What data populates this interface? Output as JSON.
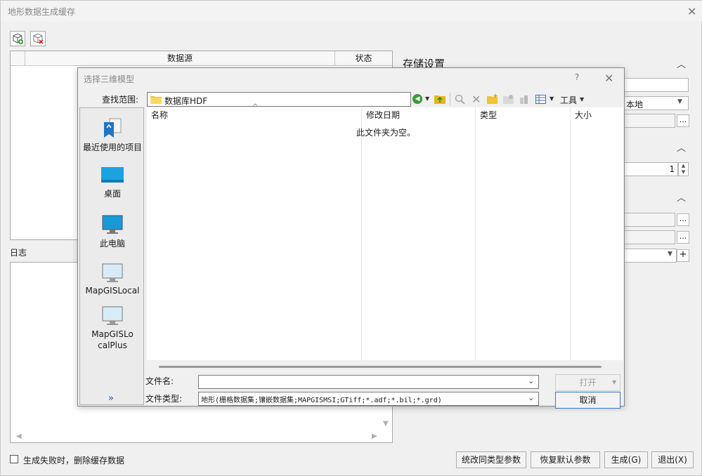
{
  "window": {
    "title": "地形数据生成缓存",
    "close_glyph": "✕"
  },
  "toolbar": {
    "add_icon": "add-model-icon",
    "remove_icon": "remove-model-icon"
  },
  "grid": {
    "columns": [
      "数据源",
      "状态"
    ]
  },
  "log": {
    "label": "日志"
  },
  "storage": {
    "title": "存储设置",
    "location_value": "本地",
    "browse_label": "...",
    "spin_value": "1",
    "plus_label": "+"
  },
  "bottom": {
    "delete_cache_label": "生成失败时，删除缓存数据",
    "buttons": [
      "统改同类型参数",
      "恢复默认参数",
      "生成(G)",
      "退出(X)"
    ]
  },
  "dialog": {
    "title": "选择三维模型",
    "help": "?",
    "close": "✕",
    "look_in_label": "查找范围:",
    "look_in_value": "数据库HDF",
    "tools_label": "工具",
    "places": [
      "最近使用的项目",
      "桌面",
      "此电脑",
      "MapGISLocal",
      "MapGISLocalPlus"
    ],
    "more_glyph": "»",
    "columns": [
      "名称",
      "修改日期",
      "类型",
      "大小"
    ],
    "empty_text": "此文件夹为空。",
    "filename_label": "文件名:",
    "filename_value": "",
    "filetype_label": "文件类型:",
    "filetype_value": "地形(栅格数据集;镶嵌数据集;MAPGISMSI;GTiff;*.adf;*.bil;*.grd)",
    "open_label": "打开",
    "cancel_label": "取消"
  }
}
